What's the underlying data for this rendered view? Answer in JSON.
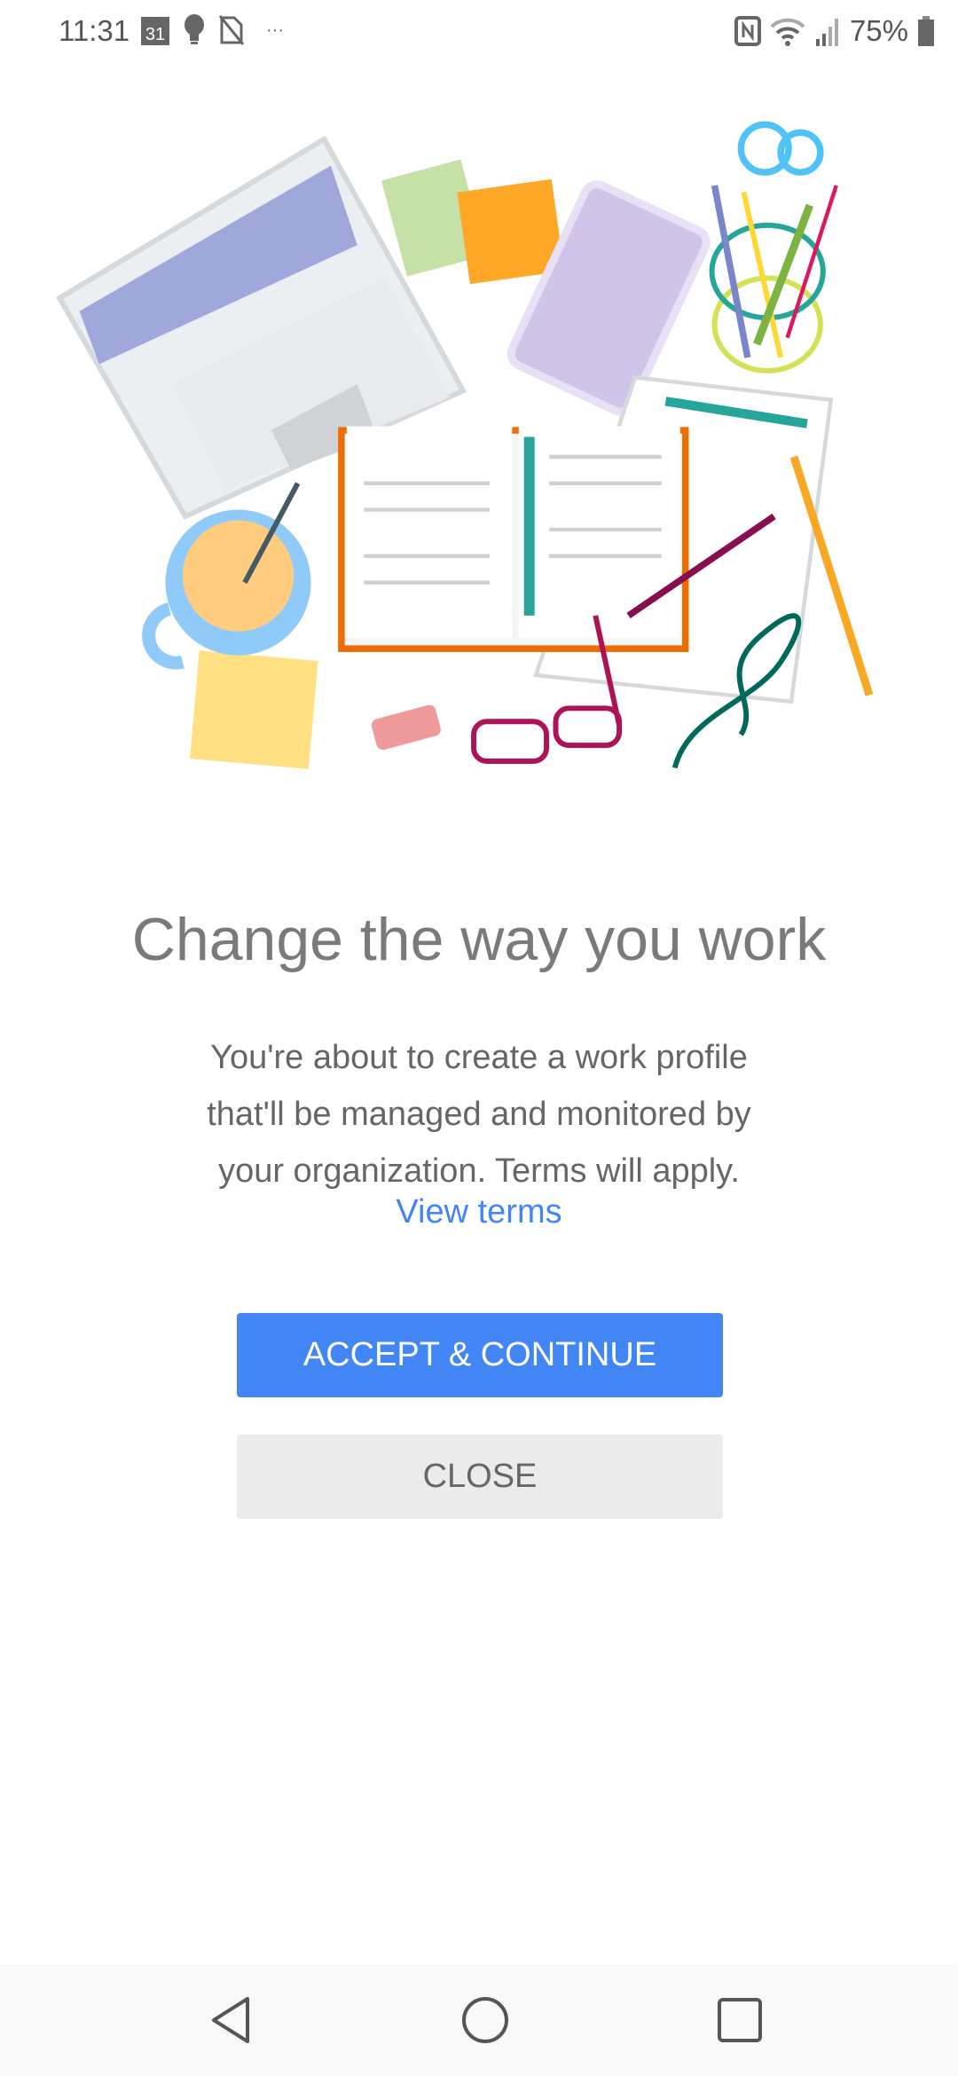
{
  "status_bar": {
    "time": "11:31",
    "calendar_day": "31",
    "battery": "75%",
    "left_icons": [
      "calendar-icon",
      "bulb-icon",
      "no-sim-icon",
      "more-notifications-icon"
    ],
    "right_icons": [
      "nfc-icon",
      "wifi-icon",
      "signal-icon",
      "battery-icon"
    ]
  },
  "main": {
    "title": "Change the way you work",
    "body_lines": [
      "You're about to create a work profile",
      "that'll be managed and monitored by",
      "your organization. Terms will apply."
    ],
    "view_terms": "View terms",
    "accept_label": "ACCEPT & CONTINUE",
    "close_label": "CLOSE"
  },
  "colors": {
    "accent": "#4285f4",
    "close_bg": "#ebebeb",
    "text": "#666666"
  },
  "nav_bar": {
    "icons": [
      "back-icon",
      "home-icon",
      "recents-icon"
    ]
  }
}
